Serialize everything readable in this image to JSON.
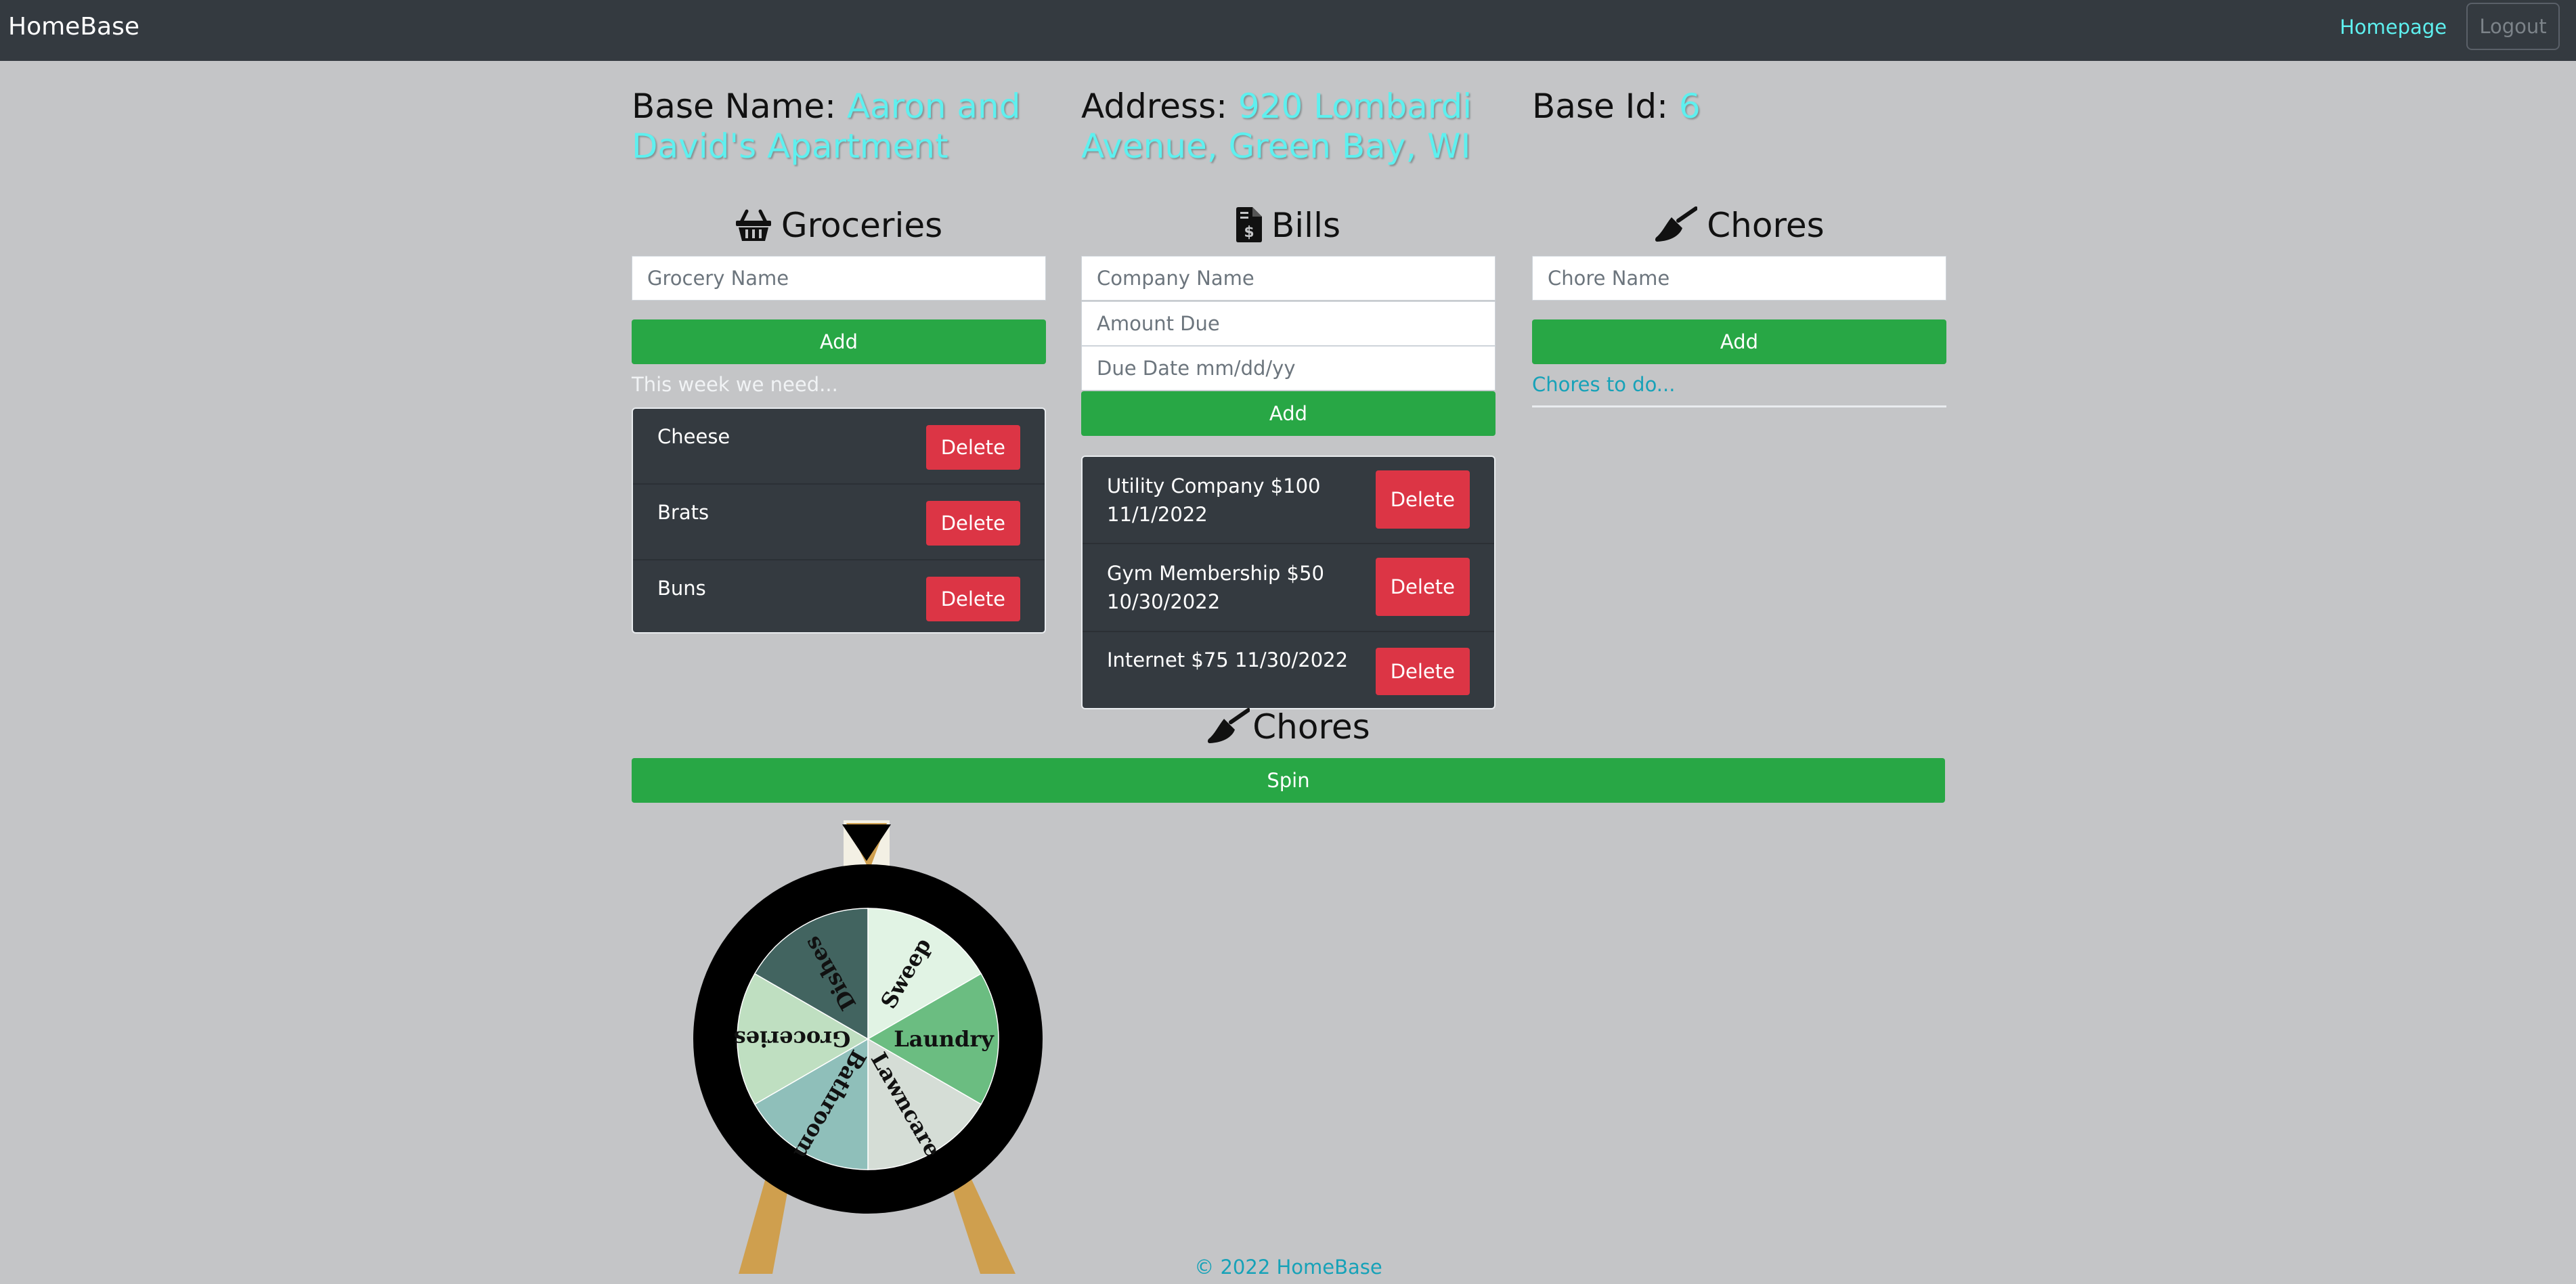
{
  "colors": {
    "navbar_bg": "#343a40",
    "page_bg": "#c4c5c7",
    "accent_cyan": "#5ef0ef",
    "link_teal": "#17a2b8",
    "add_green": "#28a745",
    "delete_red": "#dc3545",
    "list_dark": "#343a40"
  },
  "nav": {
    "brand": "HomeBase",
    "homepage_link": "Homepage",
    "logout_button": "Logout"
  },
  "base": {
    "name_label": "Base Name:",
    "name_value": "Aaron and David's Apartment",
    "address_label": "Address:",
    "address_value": "920 Lombardi Avenue, Green Bay, WI",
    "id_label": "Base Id:",
    "id_value": "6"
  },
  "groceries": {
    "icon": "shopping-basket-icon",
    "title": "Groceries",
    "input_placeholder": "Grocery Name",
    "add_label": "Add",
    "caption": "This week we need...",
    "caption_color": "#f1f3f5",
    "delete_label": "Delete",
    "items": [
      "Cheese",
      "Brats",
      "Buns"
    ]
  },
  "bills": {
    "icon": "file-invoice-dollar-icon",
    "title": "Bills",
    "company_placeholder": "Company Name",
    "amount_placeholder": "Amount Due",
    "date_placeholder": "Due Date mm/dd/yy",
    "add_label": "Add",
    "delete_label": "Delete",
    "items": [
      "Utility Company $100 11/1/2022",
      "Gym Membership $50 10/30/2022",
      "Internet $75 11/30/2022"
    ]
  },
  "chores": {
    "icon": "broom-icon",
    "title": "Chores",
    "input_placeholder": "Chore Name",
    "add_label": "Add",
    "caption": "Chores to do..."
  },
  "wheel": {
    "icon": "broom-icon",
    "title": "Chores",
    "spin_label": "Spin",
    "segments": [
      {
        "label": "Sweep",
        "color": "#e1f3e4"
      },
      {
        "label": "Laundry",
        "color": "#6bbd81"
      },
      {
        "label": "Lawncare",
        "color": "#d5ddd6"
      },
      {
        "label": "Bathroom",
        "color": "#8fbfba"
      },
      {
        "label": "Groceries",
        "color": "#bfdfc1"
      },
      {
        "label": "Dishes",
        "color": "#426460"
      }
    ]
  },
  "footer": {
    "copyright": "© 2022 HomeBase"
  }
}
